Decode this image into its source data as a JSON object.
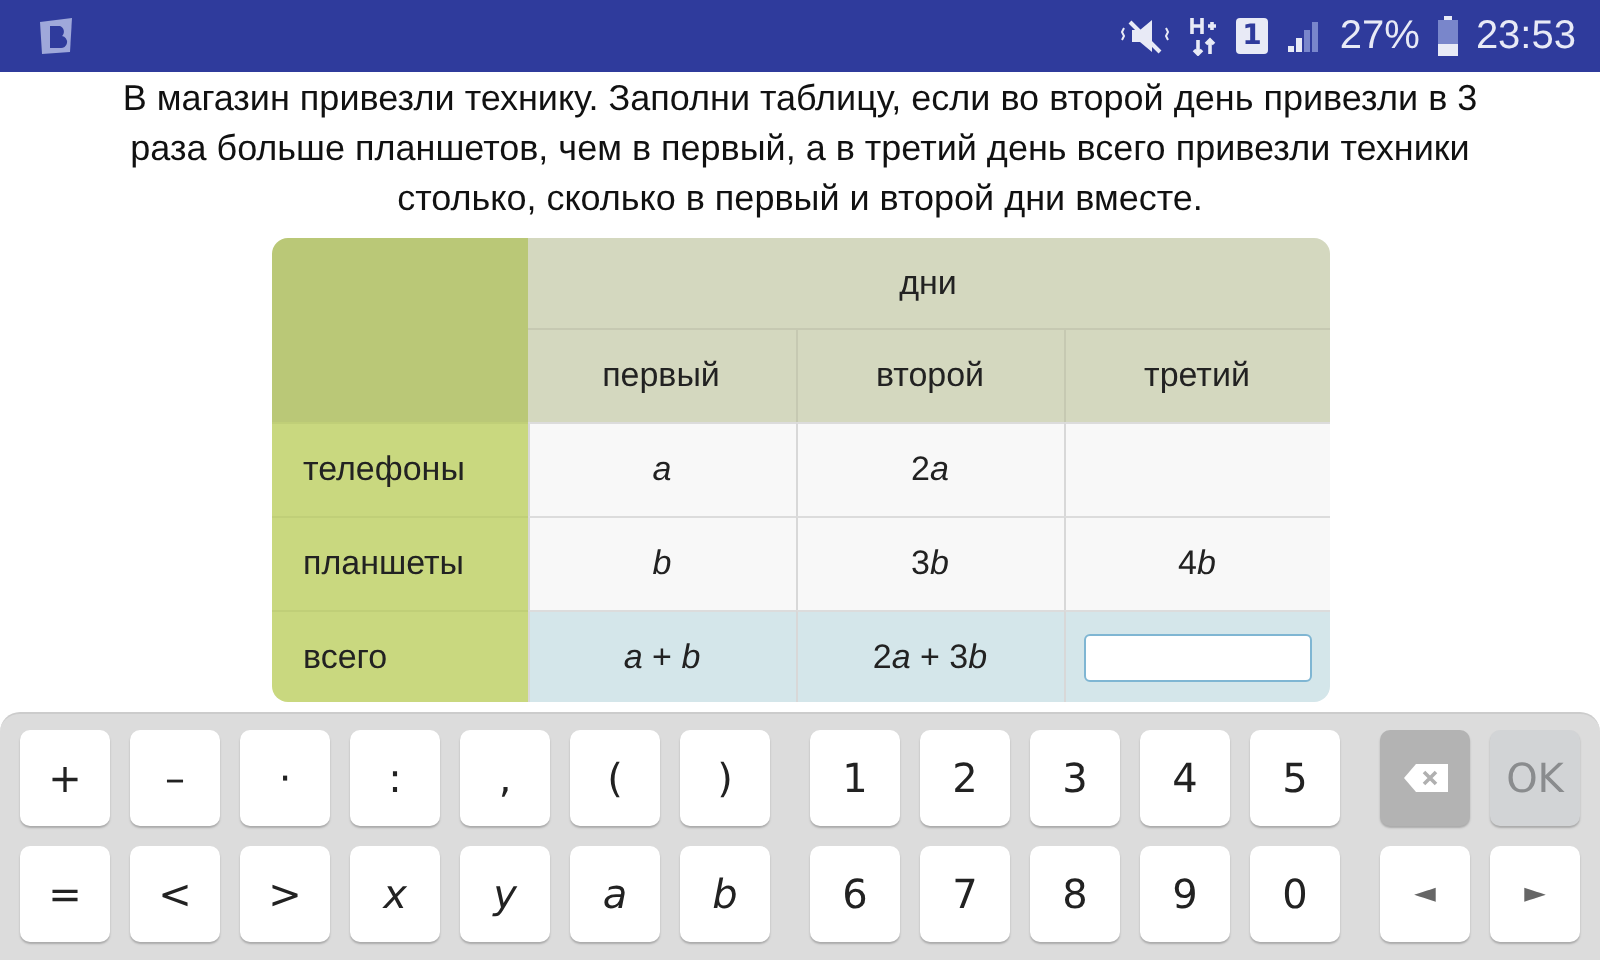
{
  "status_bar": {
    "sim": "1",
    "battery": "27%",
    "time": "23:53"
  },
  "task": {
    "text": "В магазин привезли технику. Заполни таблицу, если во второй день привезли в 3 раза больше планшетов, чем в первый, а в третий день всего привезли техники столько, сколько в первый и второй дни вместе."
  },
  "table": {
    "group_header": "дни",
    "columns": [
      "первый",
      "второй",
      "третий"
    ],
    "rows": [
      {
        "label": "телефоны",
        "kind": "data",
        "cells": [
          {
            "kind": "text",
            "parts": [
              {
                "text": "a",
                "kind": "var"
              }
            ]
          },
          {
            "kind": "text",
            "parts": [
              {
                "text": "2",
                "kind": "num"
              },
              {
                "text": "a",
                "kind": "var"
              }
            ]
          },
          {
            "kind": "empty"
          }
        ]
      },
      {
        "label": "планшеты",
        "kind": "data",
        "cells": [
          {
            "kind": "text",
            "parts": [
              {
                "text": "b",
                "kind": "var"
              }
            ]
          },
          {
            "kind": "text",
            "parts": [
              {
                "text": "3",
                "kind": "num"
              },
              {
                "text": "b",
                "kind": "var"
              }
            ]
          },
          {
            "kind": "text",
            "parts": [
              {
                "text": "4",
                "kind": "num"
              },
              {
                "text": "b",
                "kind": "var"
              }
            ]
          }
        ]
      },
      {
        "label": "всего",
        "kind": "total",
        "cells": [
          {
            "kind": "text",
            "parts": [
              {
                "text": "a",
                "kind": "var"
              },
              {
                "text": " + ",
                "kind": "num"
              },
              {
                "text": "b",
                "kind": "var"
              }
            ]
          },
          {
            "kind": "text",
            "parts": [
              {
                "text": "2",
                "kind": "num"
              },
              {
                "text": "a",
                "kind": "var"
              },
              {
                "text": " + 3",
                "kind": "num"
              },
              {
                "text": "b",
                "kind": "var"
              }
            ]
          },
          {
            "kind": "input",
            "focused": true
          }
        ]
      }
    ]
  },
  "keyboard": {
    "rows": [
      {
        "symbols": [
          {
            "label": "+",
            "kind": "symbol"
          },
          {
            "label": "–",
            "kind": "symbol"
          },
          {
            "label": "·",
            "kind": "symbol"
          },
          {
            "label": ":",
            "kind": "symbol"
          },
          {
            "label": ",",
            "kind": "symbol"
          },
          {
            "label": "(",
            "kind": "symbol"
          },
          {
            "label": ")",
            "kind": "symbol"
          }
        ],
        "digits": [
          "1",
          "2",
          "3",
          "4",
          "5"
        ],
        "actions": [
          {
            "kind": "backspace",
            "disabled": false
          },
          {
            "kind": "ok",
            "label": "OK",
            "disabled": true
          }
        ]
      },
      {
        "symbols": [
          {
            "label": "=",
            "kind": "symbol"
          },
          {
            "label": "<",
            "kind": "symbol"
          },
          {
            "label": ">",
            "kind": "symbol"
          },
          {
            "label": "x",
            "kind": "variable"
          },
          {
            "label": "y",
            "kind": "variable"
          },
          {
            "label": "a",
            "kind": "variable"
          },
          {
            "label": "b",
            "kind": "variable"
          }
        ],
        "digits": [
          "6",
          "7",
          "8",
          "9",
          "0"
        ],
        "actions": [
          {
            "kind": "arrow",
            "label": "◄",
            "disabled": false
          },
          {
            "kind": "arrow",
            "label": "►",
            "disabled": false
          }
        ]
      }
    ]
  }
}
